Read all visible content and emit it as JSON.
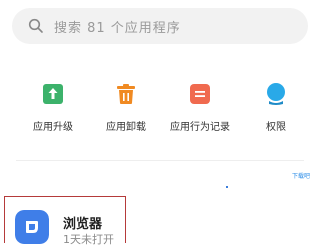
{
  "search": {
    "placeholder": "搜索 81 个应用程序",
    "icon": "search-icon"
  },
  "shortcuts": [
    {
      "label": "应用升级",
      "icon": "upgrade-icon",
      "color": "#3cb26b"
    },
    {
      "label": "应用卸载",
      "icon": "trash-icon",
      "color": "#f08a22"
    },
    {
      "label": "应用行为记录",
      "icon": "record-icon",
      "color": "#f06a4f"
    },
    {
      "label": "权限",
      "icon": "permission-icon",
      "color": "#29a9e8"
    }
  ],
  "app": {
    "name": "浏览器",
    "subtitle": "1天未打开",
    "icon": "browser-icon",
    "color": "#3f7ee8"
  },
  "watermark": "下载吧"
}
